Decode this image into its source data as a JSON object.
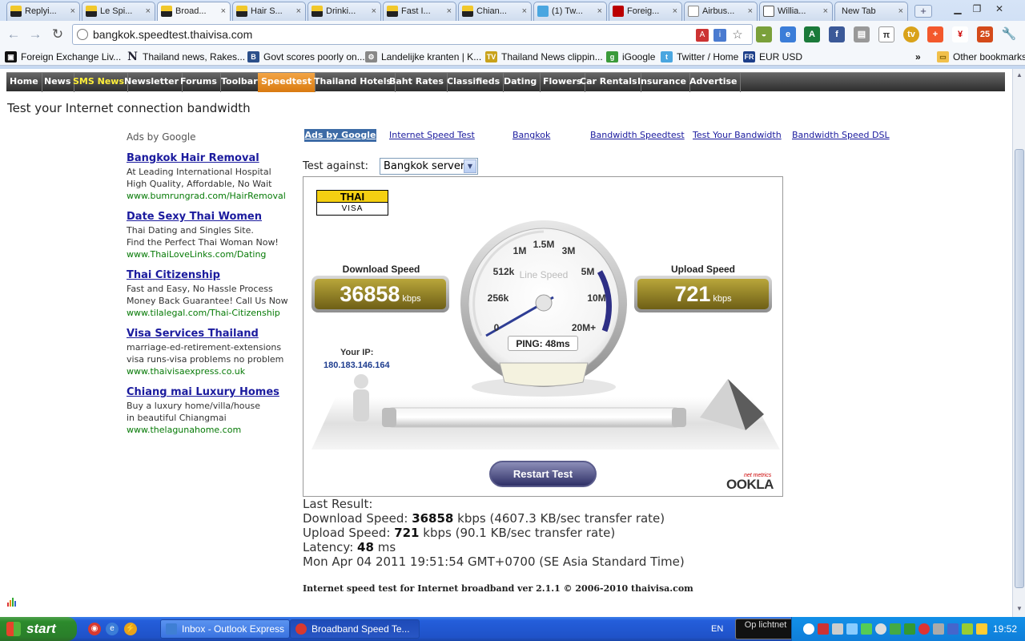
{
  "browser": {
    "tabs": [
      {
        "label": "Replyi...",
        "icon": "thaivisa-favicon"
      },
      {
        "label": "Le Spi...",
        "icon": "thaivisa-favicon"
      },
      {
        "label": "Broad...",
        "icon": "thaivisa-favicon",
        "active": true
      },
      {
        "label": "Hair S...",
        "icon": "thaivisa-favicon"
      },
      {
        "label": "Drinki...",
        "icon": "thaivisa-favicon"
      },
      {
        "label": "Fast I...",
        "icon": "thaivisa-favicon"
      },
      {
        "label": "Chian...",
        "icon": "thaivisa-favicon"
      },
      {
        "label": "(1) Tw...",
        "icon": "twitter-favicon"
      },
      {
        "label": "Foreig...",
        "icon": "forex-favicon"
      },
      {
        "label": "Airbus...",
        "icon": "document-favicon"
      },
      {
        "label": "Willia...",
        "icon": "telegraph-favicon"
      },
      {
        "label": "New Tab",
        "icon": "none"
      }
    ],
    "url": "bangkok.speedtest.thaivisa.com",
    "bookmarks": [
      {
        "label": "Foreign Exchange Liv...",
        "icon": "forex-favicon"
      },
      {
        "label": "Thailand news, Rakes...",
        "icon": "n-favicon"
      },
      {
        "label": "Govt scores poorly on...",
        "icon": "b-favicon"
      },
      {
        "label": "Landelijke kranten | K...",
        "icon": "kranten-favicon"
      },
      {
        "label": "Thailand News clippin...",
        "icon": "thaivisa-favicon"
      },
      {
        "label": "iGoogle",
        "icon": "igoogle-favicon"
      },
      {
        "label": "Twitter / Home",
        "icon": "twitter-favicon"
      },
      {
        "label": "EUR USD",
        "icon": "fr-favicon"
      }
    ],
    "bookmarks_more": "»",
    "other_bookmarks": "Other bookmarks"
  },
  "site_nav": [
    "Home",
    "News",
    "SMS News",
    "Newsletter",
    "Forums",
    "Toolbar",
    "Speedtest",
    "Thailand Hotels",
    "Baht Rates",
    "Classifieds",
    "Dating",
    "Flowers",
    "Car Rentals",
    "Insurance",
    "Advertise"
  ],
  "page_title": "Test your Internet connection bandwidth",
  "ads": {
    "label": "Ads by Google",
    "items": [
      {
        "title": "Bangkok Hair Removal",
        "lines": [
          "At Leading International Hospital",
          "High Quality, Affordable, No Wait"
        ],
        "url": "www.bumrungrad.com/HairRemoval"
      },
      {
        "title": "Date Sexy Thai Women",
        "lines": [
          "Thai Dating and Singles Site.",
          "Find the Perfect Thai Woman Now!"
        ],
        "url": "www.ThaiLoveLinks.com/Dating"
      },
      {
        "title": "Thai Citizenship",
        "lines": [
          "Fast and Easy, No Hassle Process",
          "Money Back Guarantee! Call Us Now"
        ],
        "url": "www.tilalegal.com/Thai-Citizenship"
      },
      {
        "title": "Visa Services Thailand",
        "lines": [
          "marriage-ed-retirement-extensions",
          "visa runs-visa problems no problem"
        ],
        "url": "www.thaivisaexpress.co.uk"
      },
      {
        "title": "Chiang mai Luxury Homes",
        "lines": [
          "Buy a luxury home/villa/house",
          "in beautiful Chiangmai"
        ],
        "url": "www.thelagunahome.com"
      }
    ]
  },
  "link_bar": {
    "badge": "Ads by Google",
    "links": [
      "Internet Speed Test",
      "Bangkok",
      "Bandwidth Speedtest",
      "Test Your Bandwidth",
      "Bandwidth Speed DSL"
    ]
  },
  "test_against": {
    "label": "Test against:",
    "selected": "Bangkok server"
  },
  "speedtest": {
    "logo_top": "THAI",
    "logo_bottom": "VISA",
    "download_label": "Download Speed",
    "download_value": "36858",
    "download_unit": "kbps",
    "upload_label": "Upload Speed",
    "upload_value": "721",
    "upload_unit": "kbps",
    "gauge_label": "Line Speed",
    "gauge_ticks": [
      "0",
      "256k",
      "512k",
      "1M",
      "1.5M",
      "3M",
      "5M",
      "10M",
      "20M+"
    ],
    "ping": "PING: 48ms",
    "ip_label": "Your IP:",
    "ip_value": "180.183.146.164",
    "restart_label": "Restart Test",
    "brand": "OOKLA",
    "brand_sub": "net metrics"
  },
  "results": {
    "heading": "Last Result:",
    "download_prefix": "Download Speed:",
    "download_value": "36858",
    "download_suffix": "kbps (4607.3 KB/sec transfer rate)",
    "upload_prefix": "Upload Speed:",
    "upload_value": "721",
    "upload_suffix": "kbps (90.1 KB/sec transfer rate)",
    "latency_prefix": "Latency:",
    "latency_value": "48",
    "latency_suffix": "ms",
    "timestamp": "Mon Apr 04 2011 19:51:54 GMT+0700 (SE Asia Standard Time)"
  },
  "footer_note": "Internet speed test for Internet broadband ver 2.1.1 © 2006-2010 thaivisa.com",
  "taskbar": {
    "start_label": "start",
    "buttons": [
      {
        "label": "Inbox - Outlook Express",
        "icon": "outlook-icon"
      },
      {
        "label": "Broadband Speed Te...",
        "icon": "chrome-icon",
        "active": true
      }
    ],
    "language": "EN",
    "op_lichtnet": "Op lichtnet",
    "clock": "19:52"
  },
  "colors": {
    "nav_active": "#e0861e",
    "sms_yellow": "#ffef3a",
    "ad_link": "#1b1b9e",
    "ad_url": "#067a06",
    "ip_blue": "#1e3d8f",
    "panel_gold": "#9a8a2a",
    "restart_blue": "#3a3c78"
  }
}
